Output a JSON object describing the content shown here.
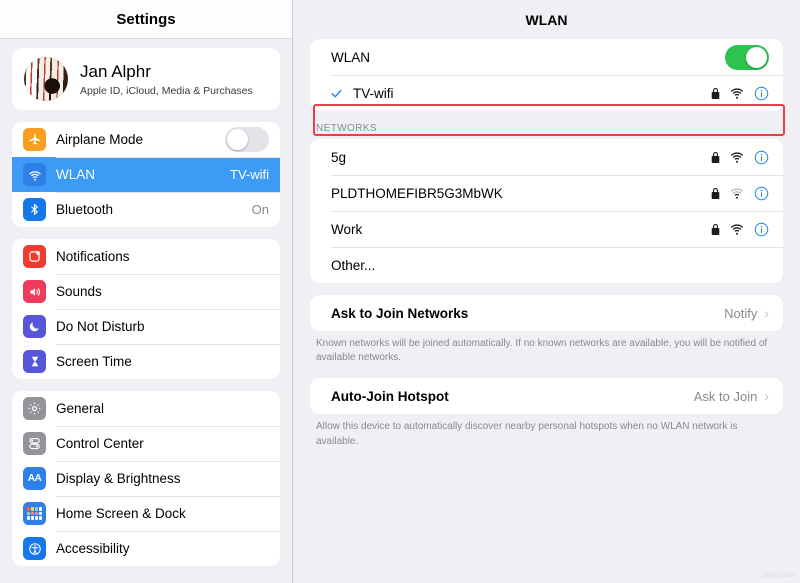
{
  "sidebar": {
    "header_title": "Settings",
    "profile": {
      "name": "Jan Alphr",
      "subtitle": "Apple ID, iCloud, Media & Purchases",
      "avatar_icon": "bowling-photo"
    },
    "group_connectivity": [
      {
        "label": "Airplane Mode",
        "icon": "airplane-icon",
        "control": "toggle",
        "toggle_state": "off",
        "value": ""
      },
      {
        "label": "WLAN",
        "icon": "wifi-icon",
        "control": "value",
        "value": "TV-wifi",
        "selected": true
      },
      {
        "label": "Bluetooth",
        "icon": "bluetooth-icon",
        "control": "value",
        "value": "On",
        "selected": false
      }
    ],
    "group_alerts": [
      {
        "label": "Notifications",
        "icon": "notifications-icon"
      },
      {
        "label": "Sounds",
        "icon": "sounds-icon"
      },
      {
        "label": "Do Not Disturb",
        "icon": "moon-icon"
      },
      {
        "label": "Screen Time",
        "icon": "hourglass-icon"
      }
    ],
    "group_system": [
      {
        "label": "General",
        "icon": "gear-icon"
      },
      {
        "label": "Control Center",
        "icon": "sliders-icon"
      },
      {
        "label": "Display & Brightness",
        "icon": "aa-icon"
      },
      {
        "label": "Home Screen & Dock",
        "icon": "app-grid-icon"
      },
      {
        "label": "Accessibility",
        "icon": "accessibility-icon"
      }
    ]
  },
  "main": {
    "header_title": "WLAN",
    "wlan_toggle": {
      "label": "WLAN",
      "state": "on"
    },
    "connected_network": {
      "name": "TV-wifi",
      "checkmark": true,
      "lock": true,
      "signal": "strong",
      "info": "info-icon"
    },
    "networks_section_label": "NETWORKS",
    "networks": [
      {
        "name": "5g",
        "lock": true,
        "signal": "strong",
        "info": true
      },
      {
        "name": "PLDTHOMEFIBR5G3MbWK",
        "lock": true,
        "signal": "weak",
        "info": true
      },
      {
        "name": "Work",
        "lock": true,
        "signal": "strong",
        "info": true
      },
      {
        "name": "Other...",
        "lock": false,
        "signal": "none",
        "info": false
      }
    ],
    "ask_to_join": {
      "label": "Ask to Join Networks",
      "value": "Notify",
      "footnote": "Known networks will be joined automatically. If no known networks are available, you will be notified of available networks."
    },
    "auto_join_hotspot": {
      "label": "Auto-Join Hotspot",
      "value": "Ask to Join",
      "footnote": "Allow this device to automatically discover nearby personal hotspots when no WLAN network is available."
    }
  },
  "annotation": {
    "target": "TV-wifi",
    "color": "#e8404a"
  },
  "watermark": "alphr.com",
  "colors": {
    "accent_blue": "#3e9bf5",
    "toggle_green": "#2ec24e",
    "annotation_red": "#e8404a",
    "background": "#efeff4"
  }
}
